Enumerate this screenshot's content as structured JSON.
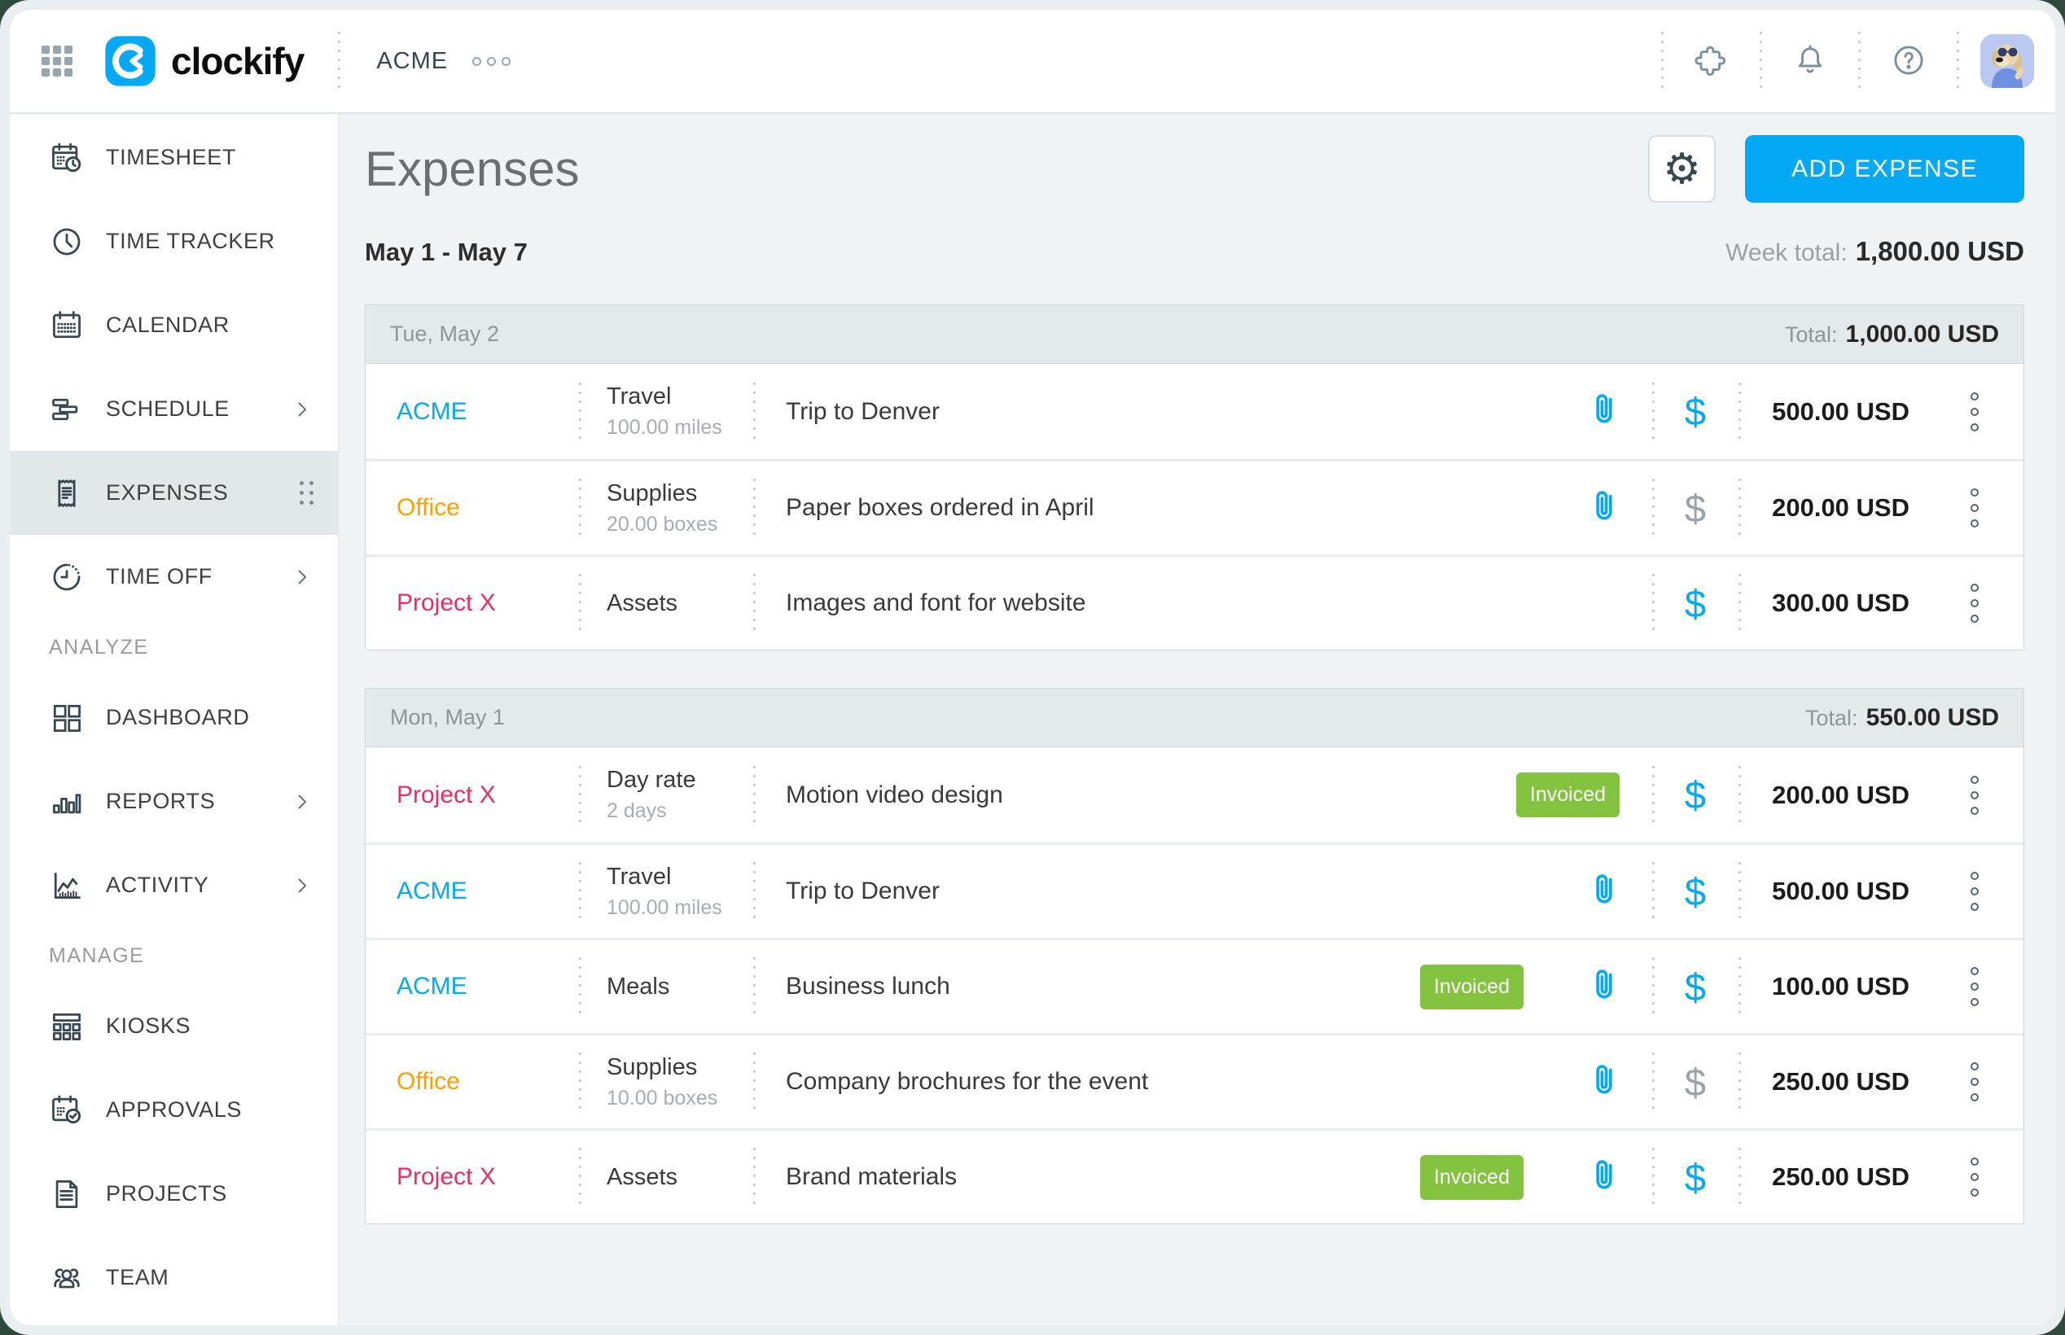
{
  "colors": {
    "accent": "#03a9f4",
    "billable": "#03a9f4",
    "nonbillable": "#9aa3a9",
    "invoiced_bg": "#84c340",
    "client_colors": {
      "ACME": "#03a9f4",
      "Office": "#ffa000",
      "Project X": "#ea2e63"
    }
  },
  "topbar": {
    "brand": "clockify",
    "workspace": "ACME"
  },
  "sidebar": {
    "groups": [
      {
        "section": "",
        "items": [
          {
            "id": "timesheet",
            "label": "TIMESHEET"
          },
          {
            "id": "time-tracker",
            "label": "TIME TRACKER"
          },
          {
            "id": "calendar",
            "label": "CALENDAR"
          },
          {
            "id": "schedule",
            "label": "SCHEDULE",
            "chevron": true
          },
          {
            "id": "expenses",
            "label": "EXPENSES",
            "active": true
          },
          {
            "id": "time-off",
            "label": "TIME OFF",
            "chevron": true
          }
        ]
      },
      {
        "section": "ANALYZE",
        "items": [
          {
            "id": "dashboard",
            "label": "DASHBOARD"
          },
          {
            "id": "reports",
            "label": "REPORTS",
            "chevron": true
          },
          {
            "id": "activity",
            "label": "ACTIVITY",
            "chevron": true
          }
        ]
      },
      {
        "section": "MANAGE",
        "items": [
          {
            "id": "kiosks",
            "label": "KIOSKS"
          },
          {
            "id": "approvals",
            "label": "APPROVALS"
          },
          {
            "id": "projects",
            "label": "PROJECTS"
          },
          {
            "id": "team",
            "label": "TEAM"
          }
        ]
      }
    ]
  },
  "header": {
    "title": "Expenses",
    "add_button": "ADD EXPENSE",
    "date_range": "May 1 - May 7",
    "week_total_label": "Week total:",
    "week_total": "1,800.00 USD"
  },
  "table": {
    "total_label": "Total:",
    "invoiced_label": "Invoiced",
    "groups": [
      {
        "day": "Tue, May 2",
        "total": "1,000.00 USD",
        "rows": [
          {
            "client": "ACME",
            "category": "Travel",
            "quantity": "100.00 miles",
            "description": "Trip to Denver",
            "invoiced": false,
            "attachment": true,
            "billable": true,
            "amount": "500.00 USD"
          },
          {
            "client": "Office",
            "category": "Supplies",
            "quantity": "20.00 boxes",
            "description": "Paper boxes ordered in April",
            "invoiced": false,
            "attachment": true,
            "billable": false,
            "amount": "200.00 USD"
          },
          {
            "client": "Project X",
            "category": "Assets",
            "quantity": "",
            "description": "Images and font for website",
            "invoiced": false,
            "attachment": false,
            "billable": true,
            "amount": "300.00 USD"
          }
        ]
      },
      {
        "day": "Mon, May 1",
        "total": "550.00 USD",
        "rows": [
          {
            "client": "Project X",
            "category": "Day rate",
            "quantity": "2 days",
            "description": "Motion video design",
            "invoiced": true,
            "attachment": false,
            "billable": true,
            "amount": "200.00 USD"
          },
          {
            "client": "ACME",
            "category": "Travel",
            "quantity": "100.00 miles",
            "description": "Trip to Denver",
            "invoiced": false,
            "attachment": true,
            "billable": true,
            "amount": "500.00 USD"
          },
          {
            "client": "ACME",
            "category": "Meals",
            "quantity": "",
            "description": "Business lunch",
            "invoiced": true,
            "attachment": true,
            "billable": true,
            "amount": "100.00 USD"
          },
          {
            "client": "Office",
            "category": "Supplies",
            "quantity": "10.00 boxes",
            "description": "Company brochures for the event",
            "invoiced": false,
            "attachment": true,
            "billable": false,
            "amount": "250.00 USD"
          },
          {
            "client": "Project X",
            "category": "Assets",
            "quantity": "",
            "description": "Brand materials",
            "invoiced": true,
            "attachment": true,
            "billable": true,
            "amount": "250.00 USD"
          }
        ]
      }
    ]
  }
}
